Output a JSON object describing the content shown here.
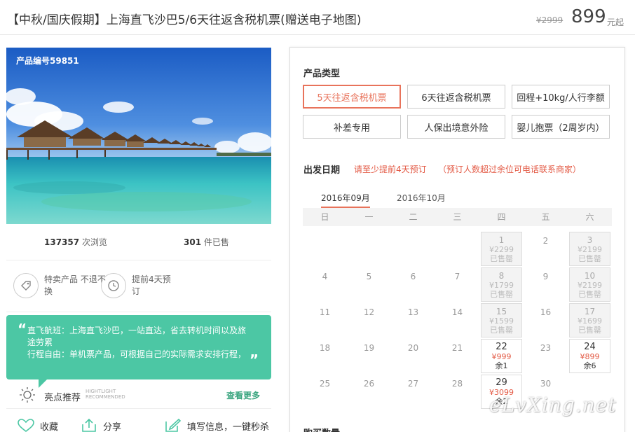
{
  "title": "【中秋/国庆假期】上海直飞沙巴5/6天往返含税机票(赠送电子地图)",
  "price": {
    "original": "¥2999",
    "current": "899",
    "unit": "元起"
  },
  "product": {
    "code": "产品编号59851",
    "views": "137357",
    "views_label": "次浏览",
    "sold": "301",
    "sold_label": "件已售"
  },
  "features": [
    {
      "icon": "tag-icon",
      "text": "特卖产品 不退不换"
    },
    {
      "icon": "clock-icon",
      "text": "提前4天预订"
    }
  ],
  "highlight": {
    "line1": "直飞航班：上海直飞沙巴，一站直达，省去转机时间以及旅",
    "line1b": "途劳累",
    "line2": "行程自由：单机票产品，可根据自己的实际需求安排行程，",
    "title": "亮点推荐",
    "en_line1": "HIGHTLIGHT",
    "en_line2": "RECOMMENDED",
    "more": "查看更多"
  },
  "actions": {
    "favorite": "收藏",
    "share": "分享",
    "fill_info": "填写信息，一键秒杀"
  },
  "booking": {
    "type_label": "产品类型",
    "types": [
      "5天往返含税机票",
      "6天往返含税机票",
      "回程+10kg/人行李额",
      "补差专用",
      "人保出境意外险",
      "婴儿抱票（2周岁内）"
    ],
    "selected_type": 0,
    "date_label": "出发日期",
    "date_tip": "请至少提前4天预订",
    "date_tip2": "（预订人数超过余位可电话联系商家）",
    "months": [
      "2016年09月",
      "2016年10月"
    ],
    "weekdays": [
      "日",
      "一",
      "二",
      "三",
      "四",
      "五",
      "六"
    ],
    "buy_label": "购买数量"
  },
  "calendar": {
    "leading_blanks": 4,
    "days": [
      {
        "d": "1",
        "state": "sold",
        "price": "¥2299",
        "status": "已售罄"
      },
      {
        "d": "2",
        "state": "plain"
      },
      {
        "d": "3",
        "state": "sold",
        "price": "¥2199",
        "status": "已售罄"
      },
      {
        "d": "4",
        "state": "plain"
      },
      {
        "d": "5",
        "state": "plain"
      },
      {
        "d": "6",
        "state": "plain"
      },
      {
        "d": "7",
        "state": "plain"
      },
      {
        "d": "8",
        "state": "sold",
        "price": "¥1799",
        "status": "已售罄"
      },
      {
        "d": "9",
        "state": "plain"
      },
      {
        "d": "10",
        "state": "sold",
        "price": "¥2199",
        "status": "已售罄"
      },
      {
        "d": "11",
        "state": "plain"
      },
      {
        "d": "12",
        "state": "plain"
      },
      {
        "d": "13",
        "state": "plain"
      },
      {
        "d": "14",
        "state": "plain"
      },
      {
        "d": "15",
        "state": "sold",
        "price": "¥1599",
        "status": "已售罄"
      },
      {
        "d": "16",
        "state": "plain"
      },
      {
        "d": "17",
        "state": "sold",
        "price": "¥1699",
        "status": "已售罄"
      },
      {
        "d": "18",
        "state": "plain"
      },
      {
        "d": "19",
        "state": "plain"
      },
      {
        "d": "20",
        "state": "plain"
      },
      {
        "d": "21",
        "state": "plain"
      },
      {
        "d": "22",
        "state": "avail",
        "price": "¥999",
        "status": "余1"
      },
      {
        "d": "23",
        "state": "plain"
      },
      {
        "d": "24",
        "state": "avail",
        "price": "¥899",
        "status": "余6"
      },
      {
        "d": "25",
        "state": "plain"
      },
      {
        "d": "26",
        "state": "plain"
      },
      {
        "d": "27",
        "state": "plain"
      },
      {
        "d": "28",
        "state": "plain"
      },
      {
        "d": "29",
        "state": "avail",
        "price": "¥3099",
        "status": "余2"
      },
      {
        "d": "30",
        "state": "plain"
      }
    ]
  },
  "watermark": "eLvXing.net",
  "colors": {
    "accent": "#e8735b",
    "price_red": "#e35a45",
    "highlight_green": "#4cc7a4",
    "link_green": "#3aa57f"
  }
}
